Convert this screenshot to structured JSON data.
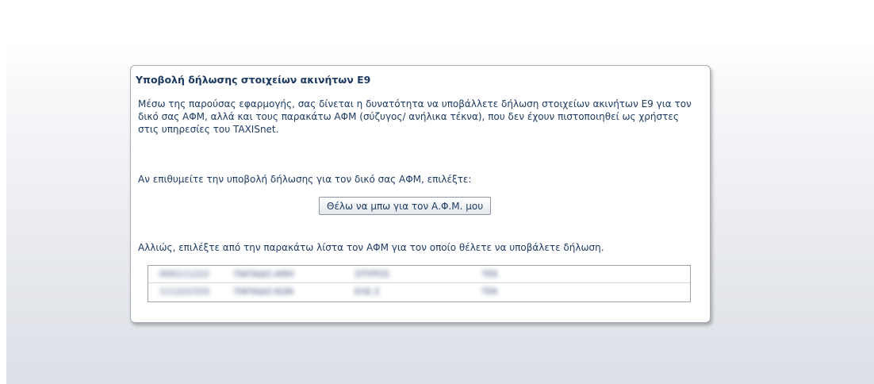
{
  "panel": {
    "title": "Υποβολή δήλωσης στοιχείων ακινήτων Ε9",
    "intro_text": "Μέσω της παρούσας εφαρμογής, σας δίνεται η δυνατότητα να υποβάλλετε δήλωση στοιχείων ακινήτων Ε9 για τον δικό σας ΑΦΜ, αλλά και τους παρακάτω ΑΦΜ (σύζυγος/ ανήλικα τέκνα), που δεν έχουν πιστοποιηθεί ως χρήστες στις υπηρεσίες του TAXISnet.",
    "own_afm_prompt": "Αν επιθυμείτε την υποβολή δήλωσης για τον δικό σας ΑΦΜ, επιλέξτε:",
    "own_afm_button": "Θέλω να μπω για τον Α.Φ.Μ. μου",
    "list_prompt": "Αλλιώς, επιλέξτε από την παρακάτω λίστα τον ΑΦΜ για τον οποίο θέλετε να υποβάλετε δήλωση."
  },
  "afm_list": {
    "rows": [
      {
        "col1": "000111222",
        "col2": "ΠΑΠΑΔΟ.ΑΘΗ",
        "col3": "ΣΠΥΡΟΣ",
        "col4": "ΤΕΚ"
      },
      {
        "col1": "111222333",
        "col2": "ΠΑΠΑΔΟ.ΚΩΝ",
        "col3": "ΕΛΕ.Σ",
        "col4": "ΤΕΚ"
      }
    ]
  }
}
